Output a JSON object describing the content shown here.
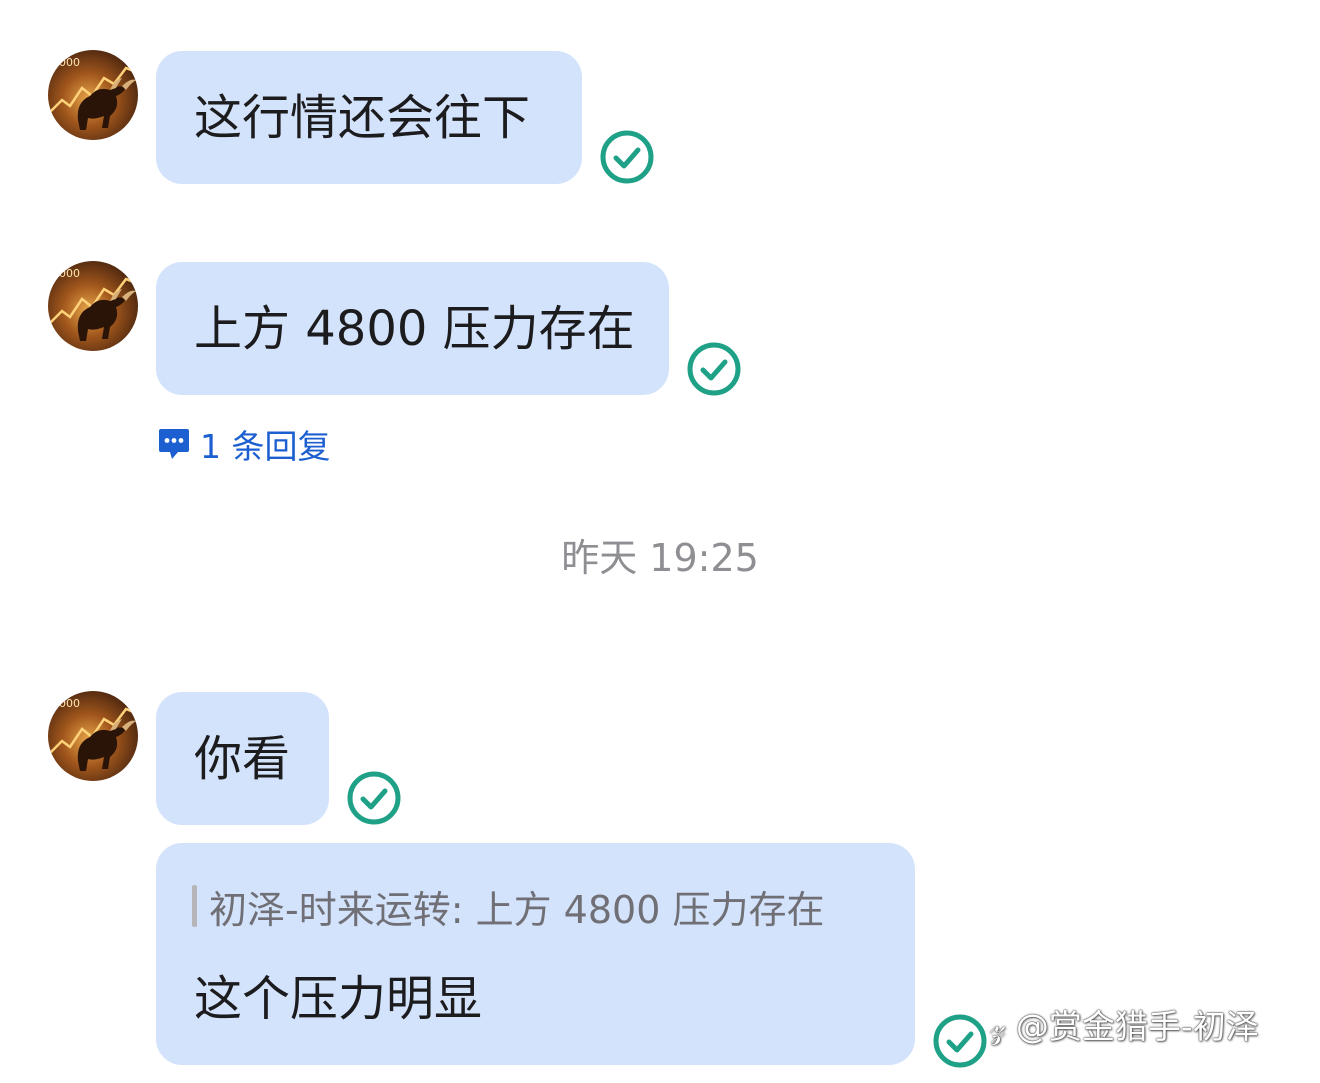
{
  "messages": [
    {
      "text": "这行情还会往下",
      "status_icon": "check-circle-icon",
      "avatar": "bull-avatar"
    },
    {
      "text": "上方 4800 压力存在",
      "status_icon": "check-circle-icon",
      "avatar": "bull-avatar",
      "thread": {
        "icon": "speech-bubble-icon",
        "label": "1 条回复"
      }
    },
    {
      "text": "你看",
      "status_icon": "check-circle-icon",
      "avatar": "bull-avatar"
    },
    {
      "quote": "初泽-时来运转: 上方 4800 压力存在",
      "text": "这个压力明显",
      "status_icon": "check-circle-icon"
    }
  ],
  "timestamp": "昨天 19:25",
  "watermark": "知乎 @赏金猎手-初泽",
  "watermark_display": "𝓏 @赏金猎手-初泽",
  "colors": {
    "bubble": "#d4e3fc",
    "check": "#1fa187",
    "link": "#1c5fd0",
    "timestamp": "#8e8e93"
  }
}
